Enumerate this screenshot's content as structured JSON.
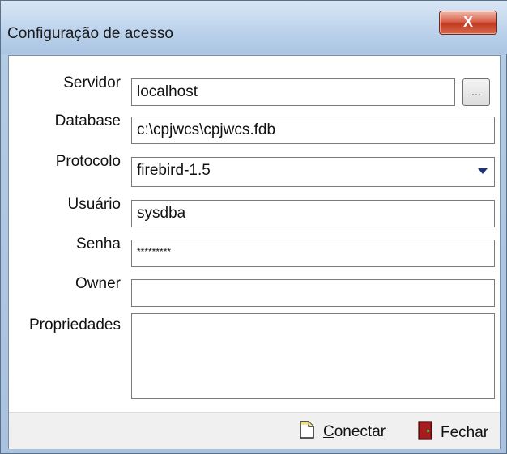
{
  "window": {
    "title": "Configuração de acesso",
    "close_label": "X"
  },
  "form": {
    "servidor": {
      "label": "Servidor",
      "value": "localhost",
      "browse_label": "..."
    },
    "database": {
      "label": "Database",
      "value": "c:\\cpjwcs\\cpjwcs.fdb"
    },
    "protocolo": {
      "label": "Protocolo",
      "value": "firebird-1.5"
    },
    "usuario": {
      "label": "Usuário",
      "value": "sysdba"
    },
    "senha": {
      "label": "Senha",
      "value": "*********"
    },
    "owner": {
      "label": "Owner",
      "value": ""
    },
    "propriedades": {
      "label": "Propriedades",
      "value": ""
    }
  },
  "actions": {
    "conectar_access": "C",
    "conectar_rest": "onectar",
    "fechar_label": "Fechar",
    "conectar_icon": "new-document-icon",
    "fechar_icon": "exit-door-icon"
  }
}
